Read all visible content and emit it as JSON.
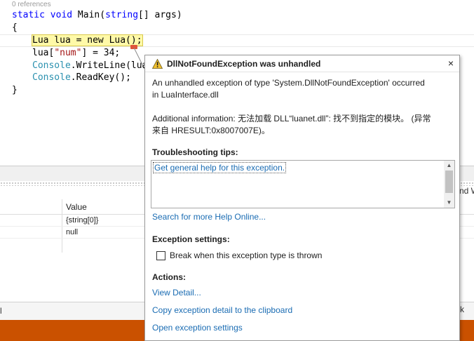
{
  "editor": {
    "codelens": "0 references",
    "lines": {
      "l1_kw1": "static",
      "l1_kw2": "void",
      "l1_name": " Main(",
      "l1_type": "string",
      "l1_rest": "[] args)",
      "l2": "{",
      "l3": "Lua lua = new Lua();",
      "l4_a": "lua[",
      "l4_str": "\"num\"",
      "l4_b": "] = 34;",
      "l5_type": "Console",
      "l5_rest": ".WriteLine(lua",
      "l6_type": "Console",
      "l6_rest": ".ReadKey();",
      "l7": "}"
    }
  },
  "locals": {
    "value_header": "Value",
    "rows": [
      "{string[0]}",
      "null"
    ]
  },
  "right_peek": "nd W",
  "bottom": {
    "left_char": "l",
    "right_char": "k"
  },
  "exception": {
    "title": "DllNotFoundException was unhandled",
    "message_line1": "An unhandled exception of type 'System.DllNotFoundException' occurred",
    "message_line2": "in LuaInterface.dll",
    "additional_line1": "Additional information: 无法加载 DLL“luanet.dll”: 找不到指定的模块。 (异常",
    "additional_line2": "来自 HRESULT:0x8007007E)。",
    "tips_heading": "Troubleshooting tips:",
    "tips_link": "Get general help for this exception.",
    "search_link": "Search for more Help Online...",
    "settings_heading": "Exception settings:",
    "checkbox_label": "Break when this exception type is thrown",
    "actions_heading": "Actions:",
    "actions": [
      "View Detail...",
      "Copy exception detail to the clipboard",
      "Open exception settings"
    ],
    "close_glyph": "×"
  },
  "colors": {
    "status_bar": "#ca5100",
    "link": "#1a6cb3",
    "statement_highlight": "#fff9a8"
  },
  "icons": [
    "warning-icon",
    "close-icon",
    "chevron-up-icon",
    "chevron-down-icon"
  ]
}
